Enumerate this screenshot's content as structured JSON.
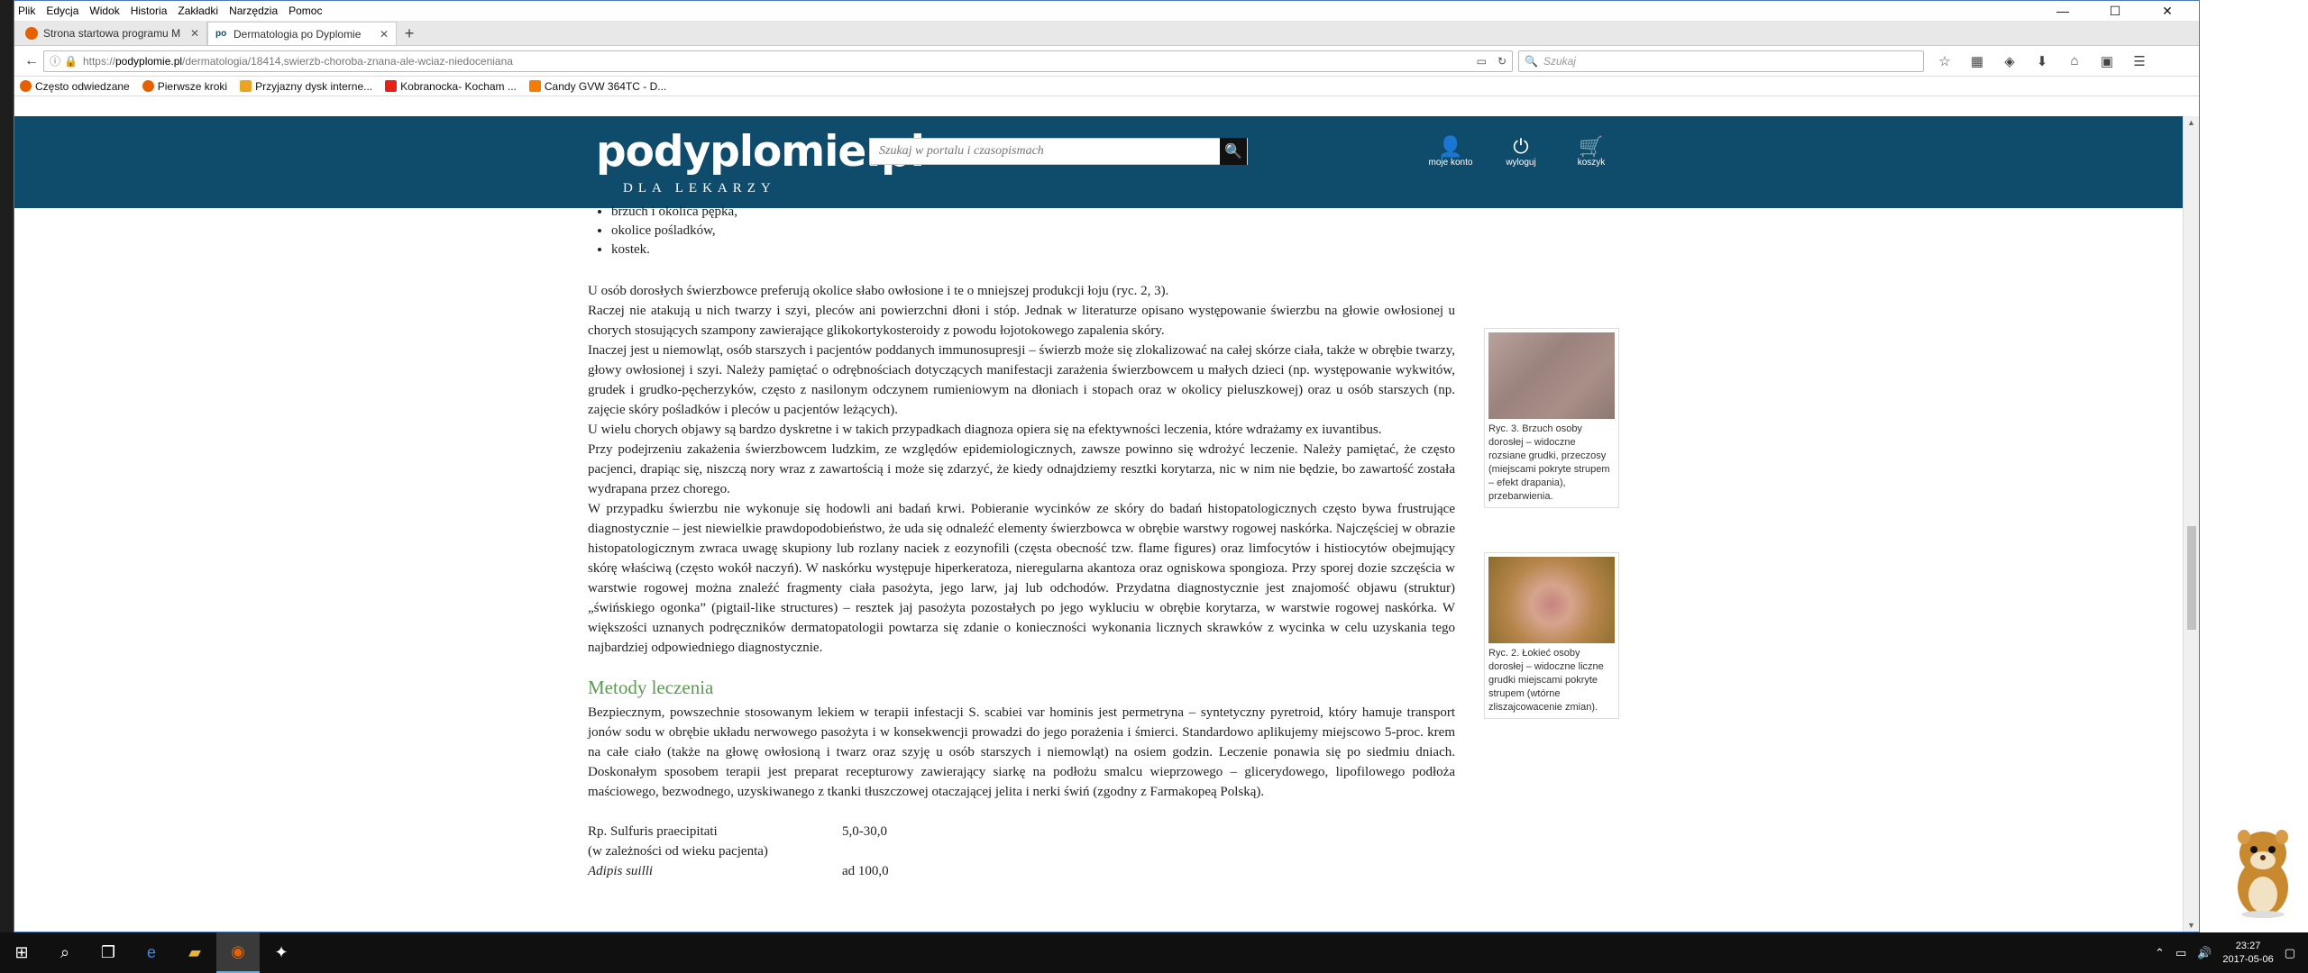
{
  "menu": [
    "Plik",
    "Edycja",
    "Widok",
    "Historia",
    "Zakładki",
    "Narzędzia",
    "Pomoc"
  ],
  "window_controls": {
    "minimize": "—",
    "maximize": "☐",
    "close": "✕"
  },
  "tabs": [
    {
      "title": "Strona startowa programu M",
      "favicon_color": "#e66000"
    },
    {
      "title": "Dermatologia po Dyplomie",
      "favicon_color": "#0f4c6c",
      "favicon_text": "po"
    }
  ],
  "url": {
    "prefix": "https://",
    "host": "podyplomie.pl",
    "path": "/dermatologia/18414,swierzb-choroba-znana-ale-wciaz-niedoceniana"
  },
  "search_placeholder": "Szukaj",
  "bookmarks": [
    {
      "label": "Często odwiedzane",
      "color": "#e66000"
    },
    {
      "label": "Pierwsze kroki",
      "color": "#e66000"
    },
    {
      "label": "Przyjazny dysk interne...",
      "color": "#e9a423"
    },
    {
      "label": "Kobranocka- Kocham ...",
      "color": "#e62117"
    },
    {
      "label": "Candy GVW 364TC - D...",
      "color": "#f57c00"
    }
  ],
  "site": {
    "logo": "podyplomie.pl",
    "logo_sub": "DLA LEKARZY",
    "search_placeholder": "Szukaj w portalu i czasopismach",
    "icons": [
      {
        "label": "moje konto",
        "glyph": "👤"
      },
      {
        "label": "wyloguj",
        "glyph": "⏻"
      },
      {
        "label": "koszyk",
        "glyph": "🛒"
      }
    ]
  },
  "article": {
    "list_items": [
      "brzuch i okolica pępka,",
      "okolice pośladków,",
      "kostek."
    ],
    "paragraphs": [
      "U osób dorosłych świerzbowce preferują okolice słabo owłosione i te o mniejszej produkcji łoju (ryc. 2, 3).",
      "Raczej nie atakują u nich twarzy i szyi, pleców ani powierzchni dłoni i stóp. Jednak w literaturze opisano występowanie świerzbu na głowie owłosionej u chorych stosujących szampony zawierające glikokortykosteroidy z powodu łojotokowego zapalenia skóry.",
      "Inaczej jest u niemowląt, osób starszych i pacjentów poddanych immunosupresji – świerzb może się zlokalizować na całej skórze ciała, także w obrębie twarzy, głowy owłosionej i szyi. Należy pamiętać o odrębnościach dotyczących manifestacji zarażenia świerzbowcem u małych dzieci (np. występowanie wykwitów, grudek i grudko-pęcherzyków, często z nasilonym odczynem rumieniowym na dłoniach i stopach oraz w okolicy pieluszkowej) oraz u osób starszych (np. zajęcie skóry pośladków i pleców u pacjentów leżących).",
      "U wielu chorych objawy są bardzo dyskretne i w takich przypadkach diagnoza opiera się na efektywności leczenia, które wdrażamy ex iuvantibus.",
      "Przy podejrzeniu zakażenia świerzbowcem ludzkim, ze względów epidemiologicznych, zawsze powinno się wdrożyć leczenie. Należy pamiętać, że często pacjenci, drapiąc się, niszczą nory wraz z zawartością i może się zdarzyć, że kiedy odnajdziemy resztki korytarza, nic w nim nie będzie, bo zawartość została wydrapana przez chorego.",
      "W przypadku świerzbu nie wykonuje się hodowli ani badań krwi. Pobieranie wycinków ze skóry do badań histopatologicznych często bywa frustrujące diagnostycznie – jest niewielkie prawdopodobieństwo, że uda się odnaleźć elementy świerzbowca w obrębie warstwy rogowej naskórka. Najczęściej w obrazie histopatologicznym zwraca uwagę skupiony lub rozlany naciek z eozynofili (częsta obecność tzw. flame figures) oraz limfocytów i histiocytów obejmujący skórę właściwą (często wokół naczyń). W naskórku występuje hiperkeratoza, nieregularna akantoza oraz ogniskowa spongioza. Przy sporej dozie szczęścia w warstwie rogowej można znaleźć fragmenty ciała pasożyta, jego larw, jaj lub odchodów. Przydatna diagnostycznie jest znajomość objawu (struktur) „świńskiego ogonka” (pigtail-like structures) – resztek jaj pasożyta pozostałych po jego wykluciu w obrębie korytarza, w warstwie rogowej naskórka. W większości uznanych podręczników dermatopatologii powtarza się zdanie o konieczności wykonania licznych skrawków z wycinka w celu uzyskania tego najbardziej odpowiedniego diagnostycznie."
    ],
    "heading": "Metody leczenia",
    "treatment": "Bezpiecznym, powszechnie stosowanym lekiem w terapii infestacji S. scabiei var hominis jest permetryna – syntetyczny pyretroid, który hamuje transport jonów sodu w obrębie układu nerwowego pasożyta i w konsekwencji prowadzi do jego porażenia i śmierci. Standardowo aplikujemy miejscowo 5-proc. krem na całe ciało (także na głowę owłosioną i twarz oraz szyję u osób starszych i niemowląt) na osiem godzin. Leczenie ponawia się po siedmiu dniach. Doskonałym sposobem terapii jest preparat recepturowy zawierający siarkę na podłożu smalcu wieprzowego – glicerydowego, lipofilowego podłoża maściowego, bezwodnego, uzyskiwanego z tkanki tłuszczowej otaczającej jelita i nerki świń (zgodny z Farmakopeą Polską).",
    "rx": [
      {
        "left": "Rp. Sulfuris praecipitati",
        "right": "5,0-30,0"
      },
      {
        "left": "(w zależności od wieku pacjenta)",
        "right": ""
      },
      {
        "left": "Adipis suilli",
        "right": "ad 100,0"
      }
    ]
  },
  "figures": [
    {
      "caption": "Ryc. 3. Brzuch osoby dorosłej – widoczne rozsiane grudki, przeczosy (miejscami pokryte strupem – efekt drapania), przebarwienia."
    },
    {
      "caption": "Ryc. 2. Łokieć osoby dorosłej – widoczne liczne grudki miejscami pokryte strupem (wtórne zliszajcowacenie zmian)."
    }
  ],
  "taskbar": {
    "time": "23:27",
    "date": "2017-05-06"
  }
}
